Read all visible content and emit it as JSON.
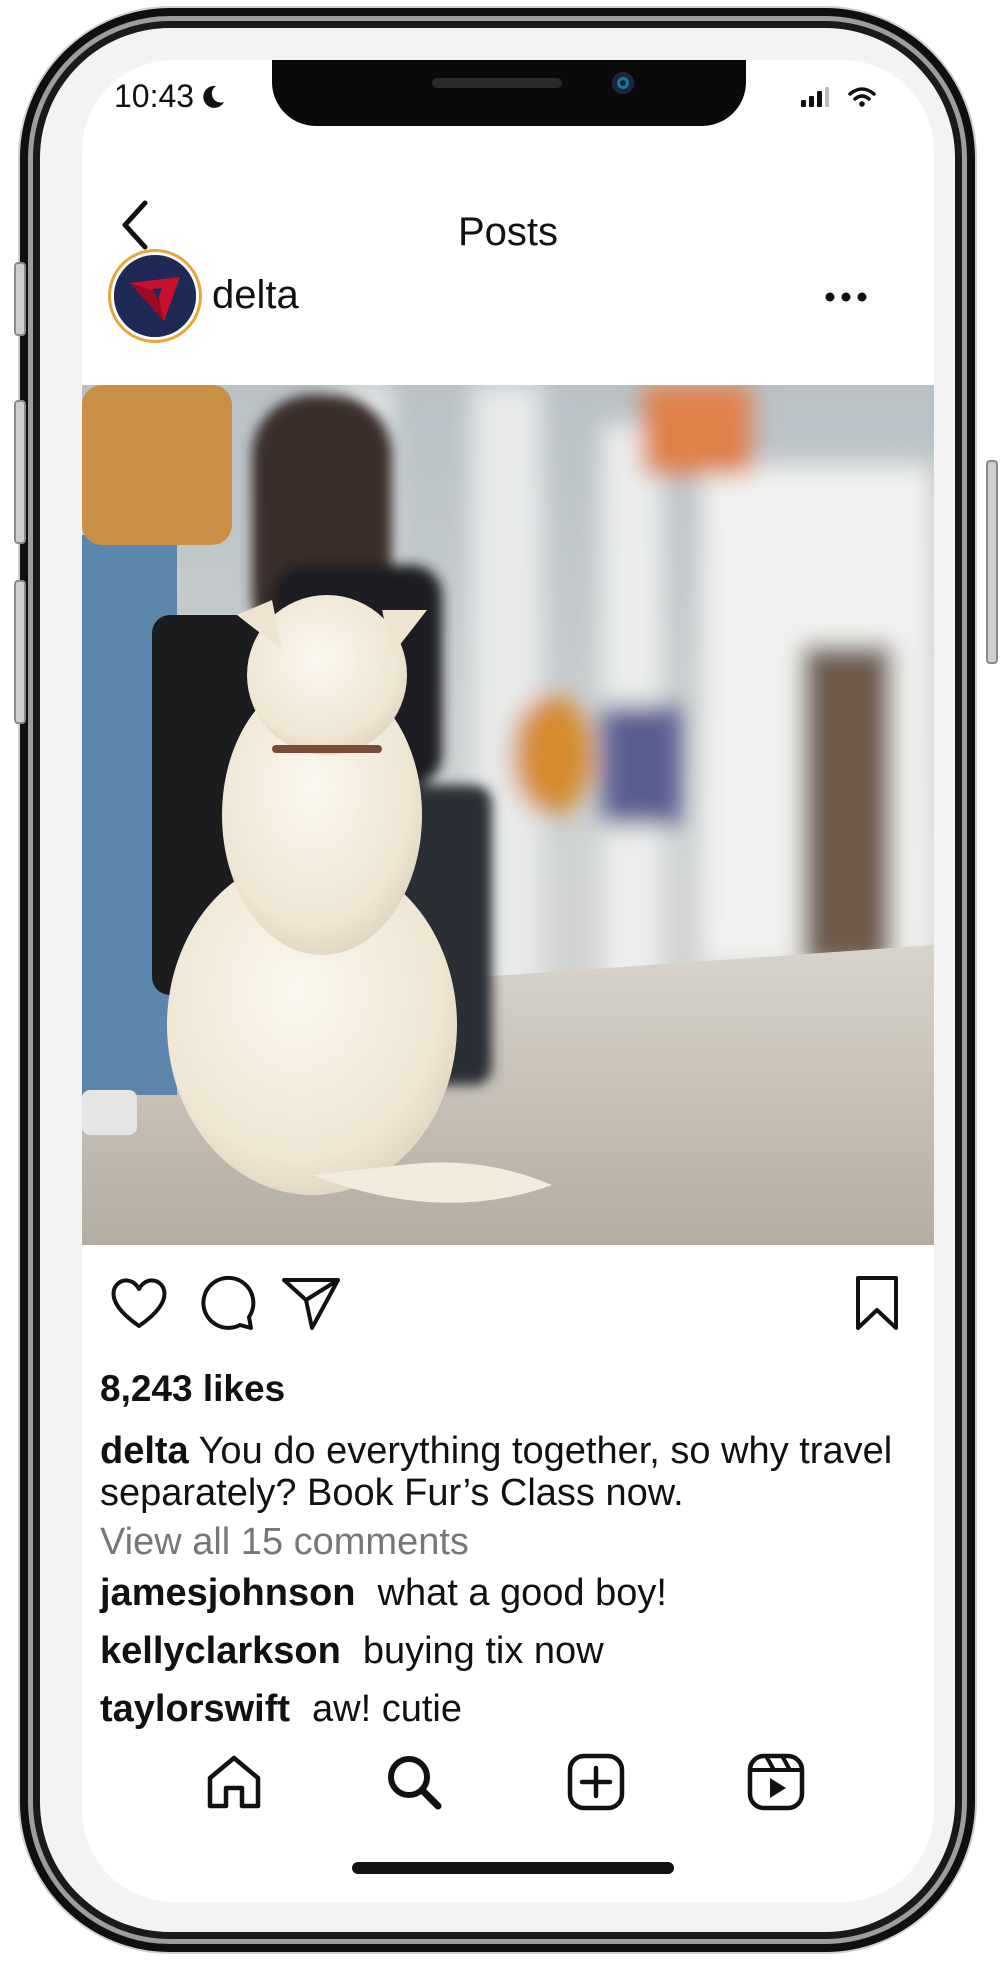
{
  "status_bar": {
    "time": "10:43"
  },
  "header": {
    "title": "Posts"
  },
  "post": {
    "username": "delta",
    "likes": "8,243 likes",
    "caption_user": "delta",
    "caption_text": "You do everything together, so why travel separately? Book Fur’s Class now.",
    "view_all_comments": "View all 15 comments",
    "comments": [
      {
        "user": "jamesjohnson",
        "text": "what a good boy!"
      },
      {
        "user": "kellyclarkson",
        "text": "buying tix now"
      },
      {
        "user": "taylorswift",
        "text": "aw! cutie"
      }
    ]
  },
  "colors": {
    "delta_navy": "#1e2a55",
    "delta_red": "#c8102e",
    "text": "#111111",
    "muted": "#777777"
  },
  "icons": {
    "status": [
      "moon-icon",
      "signal-icon",
      "wifi-icon"
    ],
    "actions": [
      "heart-icon",
      "comment-icon",
      "share-icon",
      "bookmark-icon"
    ],
    "tabs": [
      "home-icon",
      "search-icon",
      "create-icon",
      "reels-icon"
    ]
  }
}
